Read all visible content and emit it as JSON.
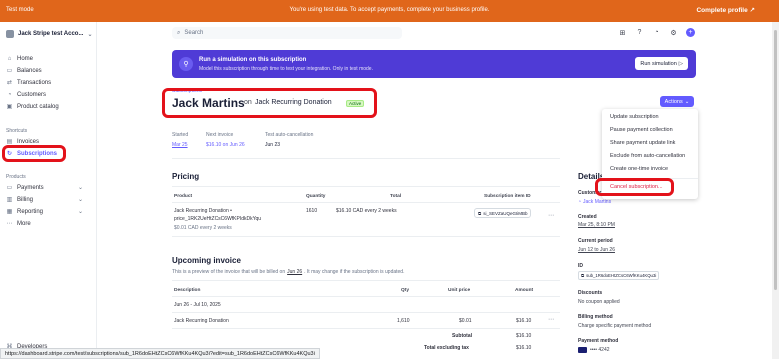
{
  "banner": {
    "left": "Test mode",
    "message": "You're using test data. To accept payments, complete your business profile.",
    "cta": "Complete profile",
    "cta_arrow": "↗"
  },
  "sidebar": {
    "account": "Jack Stripe test Acco...",
    "items": [
      {
        "label": "Home"
      },
      {
        "label": "Balances"
      },
      {
        "label": "Transactions"
      },
      {
        "label": "Customers"
      },
      {
        "label": "Product catalog"
      }
    ],
    "shortcuts_label": "Shortcuts",
    "shortcuts": [
      {
        "label": "Invoices"
      },
      {
        "label": "Subscriptions"
      }
    ],
    "products_label": "Products",
    "products": [
      {
        "label": "Payments"
      },
      {
        "label": "Billing"
      },
      {
        "label": "Reporting"
      },
      {
        "label": "More"
      }
    ],
    "developers": "Developers"
  },
  "search": {
    "placeholder": "Search"
  },
  "simulation": {
    "title": "Run a simulation on this subscription",
    "subtitle": "Model this subscription through time to test your integration. Only in test mode.",
    "button": "Run simulation"
  },
  "header": {
    "breadcrumb": "Subscriptions",
    "customer": "Jack Martins",
    "on": "on",
    "plan": "Jack Recurring Donation",
    "status": "Active",
    "actions": "Actions"
  },
  "menu": {
    "items": [
      "Update subscription",
      "Pause payment collection",
      "Share payment update link",
      "Exclude from auto-cancellation",
      "Create one-time invoice",
      "Cancel subscription..."
    ]
  },
  "meta": {
    "started_label": "Started",
    "started": "Mar 25",
    "next_invoice_label": "Next invoice",
    "next_invoice": "$16.10 on Jun 26",
    "auto_cancel_label": "Test auto-cancellation",
    "auto_cancel": "Jun 23"
  },
  "pricing": {
    "title": "Pricing",
    "headers": [
      "Product",
      "Quantity",
      "Total",
      "Subscription item ID"
    ],
    "product_name": "Jack Recurring Donation •",
    "product_price_id": "price_1RK2UeHtZCsC6WfKPIdkDkYqu",
    "product_unit": "$0.01 CAD every 2 weeks",
    "quantity": "1610",
    "total": "$16.10 CAD every 2 weeks",
    "item_id": "si_SEVZaUQeGIiMBb"
  },
  "upcoming": {
    "title": "Upcoming invoice",
    "subtitle_pre": "This is a preview of the invoice that will be billed on",
    "subtitle_date": "Jun 26",
    "subtitle_post": ". It may change if the subscription is updated.",
    "headers": [
      "Description",
      "Qty",
      "Unit price",
      "Amount"
    ],
    "period": "Jun 26 - Jul 10, 2025",
    "line_desc": "Jack Recurring Donation",
    "line_qty": "1,610",
    "line_unit": "$0.01",
    "line_amount": "$16.10",
    "subtotal_label": "Subtotal",
    "subtotal": "$16.10",
    "total_ex_tax_label": "Total excluding tax",
    "total_ex_tax": "$16.10"
  },
  "details": {
    "title": "Details",
    "customer_label": "Customer",
    "customer": "Jack Martins",
    "created_label": "Created",
    "created": "Mar 25, 8:10 PM",
    "period_label": "Current period",
    "period": "Jun 12 to Jun 26",
    "id_label": "ID",
    "id": "sub_1R6doEHtZCsC6WfKKu4KQu3i",
    "discounts_label": "Discounts",
    "discounts": "No coupon applied",
    "billing_label": "Billing method",
    "billing": "Charge specific payment method",
    "payment_label": "Payment method",
    "payment": "•••• 4242"
  },
  "status_url": "https://dashboard.stripe.com/test/subscriptions/sub_1R6doEHtZCsC6WfKKu4KQu3i?edit=sub_1R6doEHtZCsC6WfKKu4KQu3i"
}
